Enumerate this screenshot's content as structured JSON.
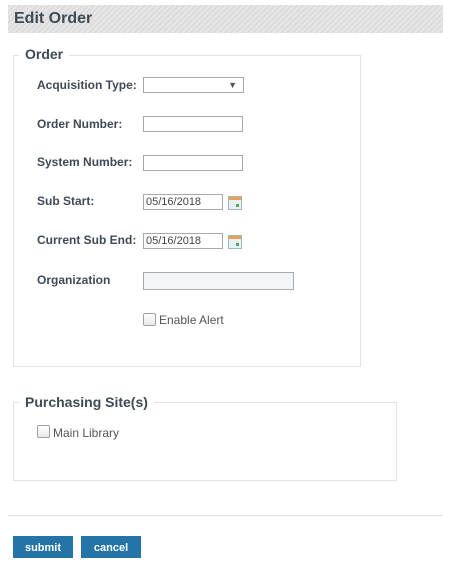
{
  "header": {
    "title": "Edit Order"
  },
  "order": {
    "legend": "Order",
    "acquisition_type": {
      "label": "Acquisition Type:",
      "value": ""
    },
    "order_number": {
      "label": "Order Number:",
      "value": ""
    },
    "system_number": {
      "label": "System Number:",
      "value": ""
    },
    "sub_start": {
      "label": "Sub Start:",
      "value": "05/16/2018"
    },
    "current_sub_end": {
      "label": "Current Sub End:",
      "value": "05/16/2018"
    },
    "organization": {
      "label": "Organization",
      "value": ""
    },
    "enable_alert": {
      "label": "Enable Alert",
      "checked": false
    }
  },
  "purchasing": {
    "legend": "Purchasing Site(s)",
    "sites": [
      {
        "label": "Main Library",
        "checked": false
      }
    ]
  },
  "actions": {
    "submit": "submit",
    "cancel": "cancel"
  },
  "colors": {
    "button": "#2474a8",
    "heading": "#3f4a55"
  }
}
